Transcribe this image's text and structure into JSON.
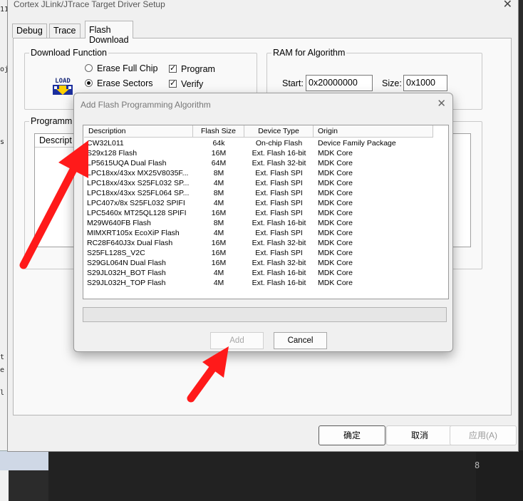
{
  "background": {
    "left_fragments": [
      "11",
      "oj",
      "s",
      "t",
      "e",
      "l"
    ],
    "right_digit": "8"
  },
  "main_window": {
    "title": "Cortex JLink/JTrace Target Driver Setup",
    "close_glyph": "✕",
    "tabs": [
      {
        "label": "Debug",
        "active": false
      },
      {
        "label": "Trace",
        "active": false
      },
      {
        "label": "Flash Download",
        "active": true
      }
    ],
    "download_function": {
      "title": "Download Function",
      "icon_label": "LOAD",
      "erase_full_chip": "Erase Full Chip",
      "erase_sectors": "Erase Sectors",
      "selected": "erase_sectors",
      "program": {
        "label": "Program",
        "checked": true
      },
      "verify": {
        "label": "Verify",
        "checked": true
      }
    },
    "ram_for_algorithm": {
      "title": "RAM for Algorithm",
      "start_label": "Start:",
      "start_value": "0x20000000",
      "size_label": "Size:",
      "size_value": "0x1000"
    },
    "programming": {
      "title": "Programm",
      "column": "Descript"
    },
    "buttons": {
      "ok": "确定",
      "cancel": "取消",
      "apply": "应用(A)"
    }
  },
  "dialog": {
    "title": "Add Flash Programming Algorithm",
    "close_glyph": "✕",
    "columns": [
      "Description",
      "Flash Size",
      "Device Type",
      "Origin"
    ],
    "rows": [
      {
        "desc": "CW32L011",
        "size": "64k",
        "type": "On-chip Flash",
        "origin": "Device Family Package"
      },
      {
        "desc": "S29x128 Flash",
        "size": "16M",
        "type": "Ext. Flash 16-bit",
        "origin": "MDK Core"
      },
      {
        "desc": "LP5615UQA Dual Flash",
        "size": "64M",
        "type": "Ext. Flash 32-bit",
        "origin": "MDK Core"
      },
      {
        "desc": "LPC18xx/43xx MX25V8035F...",
        "size": "8M",
        "type": "Ext. Flash SPI",
        "origin": "MDK Core"
      },
      {
        "desc": "LPC18xx/43xx S25FL032 SP...",
        "size": "4M",
        "type": "Ext. Flash SPI",
        "origin": "MDK Core"
      },
      {
        "desc": "LPC18xx/43xx S25FL064 SP...",
        "size": "8M",
        "type": "Ext. Flash SPI",
        "origin": "MDK Core"
      },
      {
        "desc": "LPC407x/8x S25FL032 SPIFI",
        "size": "4M",
        "type": "Ext. Flash SPI",
        "origin": "MDK Core"
      },
      {
        "desc": "LPC5460x MT25QL128 SPIFI",
        "size": "16M",
        "type": "Ext. Flash SPI",
        "origin": "MDK Core"
      },
      {
        "desc": "M29W640FB Flash",
        "size": "8M",
        "type": "Ext. Flash 16-bit",
        "origin": "MDK Core"
      },
      {
        "desc": "MIMXRT105x EcoXiP Flash",
        "size": "4M",
        "type": "Ext. Flash SPI",
        "origin": "MDK Core"
      },
      {
        "desc": "RC28F640J3x Dual Flash",
        "size": "16M",
        "type": "Ext. Flash 32-bit",
        "origin": "MDK Core"
      },
      {
        "desc": "S25FL128S_V2C",
        "size": "16M",
        "type": "Ext. Flash SPI",
        "origin": "MDK Core"
      },
      {
        "desc": "S29GL064N Dual Flash",
        "size": "16M",
        "type": "Ext. Flash 32-bit",
        "origin": "MDK Core"
      },
      {
        "desc": "S29JL032H_BOT Flash",
        "size": "4M",
        "type": "Ext. Flash 16-bit",
        "origin": "MDK Core"
      },
      {
        "desc": "S29JL032H_TOP Flash",
        "size": "4M",
        "type": "Ext. Flash 16-bit",
        "origin": "MDK Core"
      }
    ],
    "add_button": "Add",
    "cancel_button": "Cancel"
  },
  "annotations": {
    "arrow_color": "#ff1a1a"
  }
}
